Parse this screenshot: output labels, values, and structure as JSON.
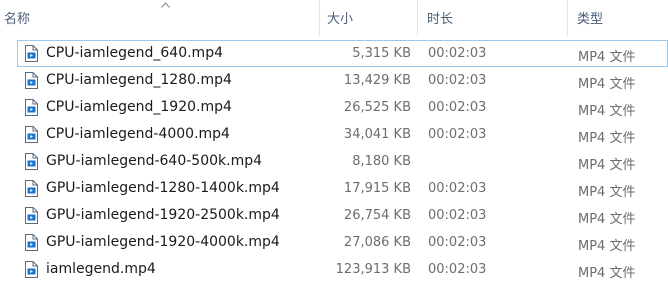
{
  "header": {
    "name_label": "名称",
    "size_label": "大小",
    "duration_label": "时长",
    "type_label": "类型"
  },
  "files": [
    {
      "name": "CPU-iamlegend_640.mp4",
      "size": "5,315 KB",
      "duration": "00:02:03",
      "type": "MP4 文件"
    },
    {
      "name": "CPU-iamlegend_1280.mp4",
      "size": "13,429 KB",
      "duration": "00:02:03",
      "type": "MP4 文件"
    },
    {
      "name": "CPU-iamlegend_1920.mp4",
      "size": "26,525 KB",
      "duration": "00:02:03",
      "type": "MP4 文件"
    },
    {
      "name": "CPU-iamlegend-4000.mp4",
      "size": "34,041 KB",
      "duration": "00:02:03",
      "type": "MP4 文件"
    },
    {
      "name": "GPU-iamlegend-640-500k.mp4",
      "size": "8,180 KB",
      "duration": "",
      "type": "MP4 文件"
    },
    {
      "name": "GPU-iamlegend-1280-1400k.mp4",
      "size": "17,915 KB",
      "duration": "00:02:03",
      "type": "MP4 文件"
    },
    {
      "name": "GPU-iamlegend-1920-2500k.mp4",
      "size": "26,754 KB",
      "duration": "00:02:03",
      "type": "MP4 文件"
    },
    {
      "name": "GPU-iamlegend-1920-4000k.mp4",
      "size": "27,086 KB",
      "duration": "00:02:03",
      "type": "MP4 文件"
    },
    {
      "name": "iamlegend.mp4",
      "size": "123,913 KB",
      "duration": "00:02:03",
      "type": "MP4 文件"
    }
  ],
  "icons": {
    "file": "video-file-icon",
    "sort": "sort-ascending-icon"
  },
  "colors": {
    "header_text": "#4c607a",
    "secondary_text": "#6d6d6d",
    "focus_outline": "#99c9ef",
    "icon_blue": "#1a74d0"
  }
}
